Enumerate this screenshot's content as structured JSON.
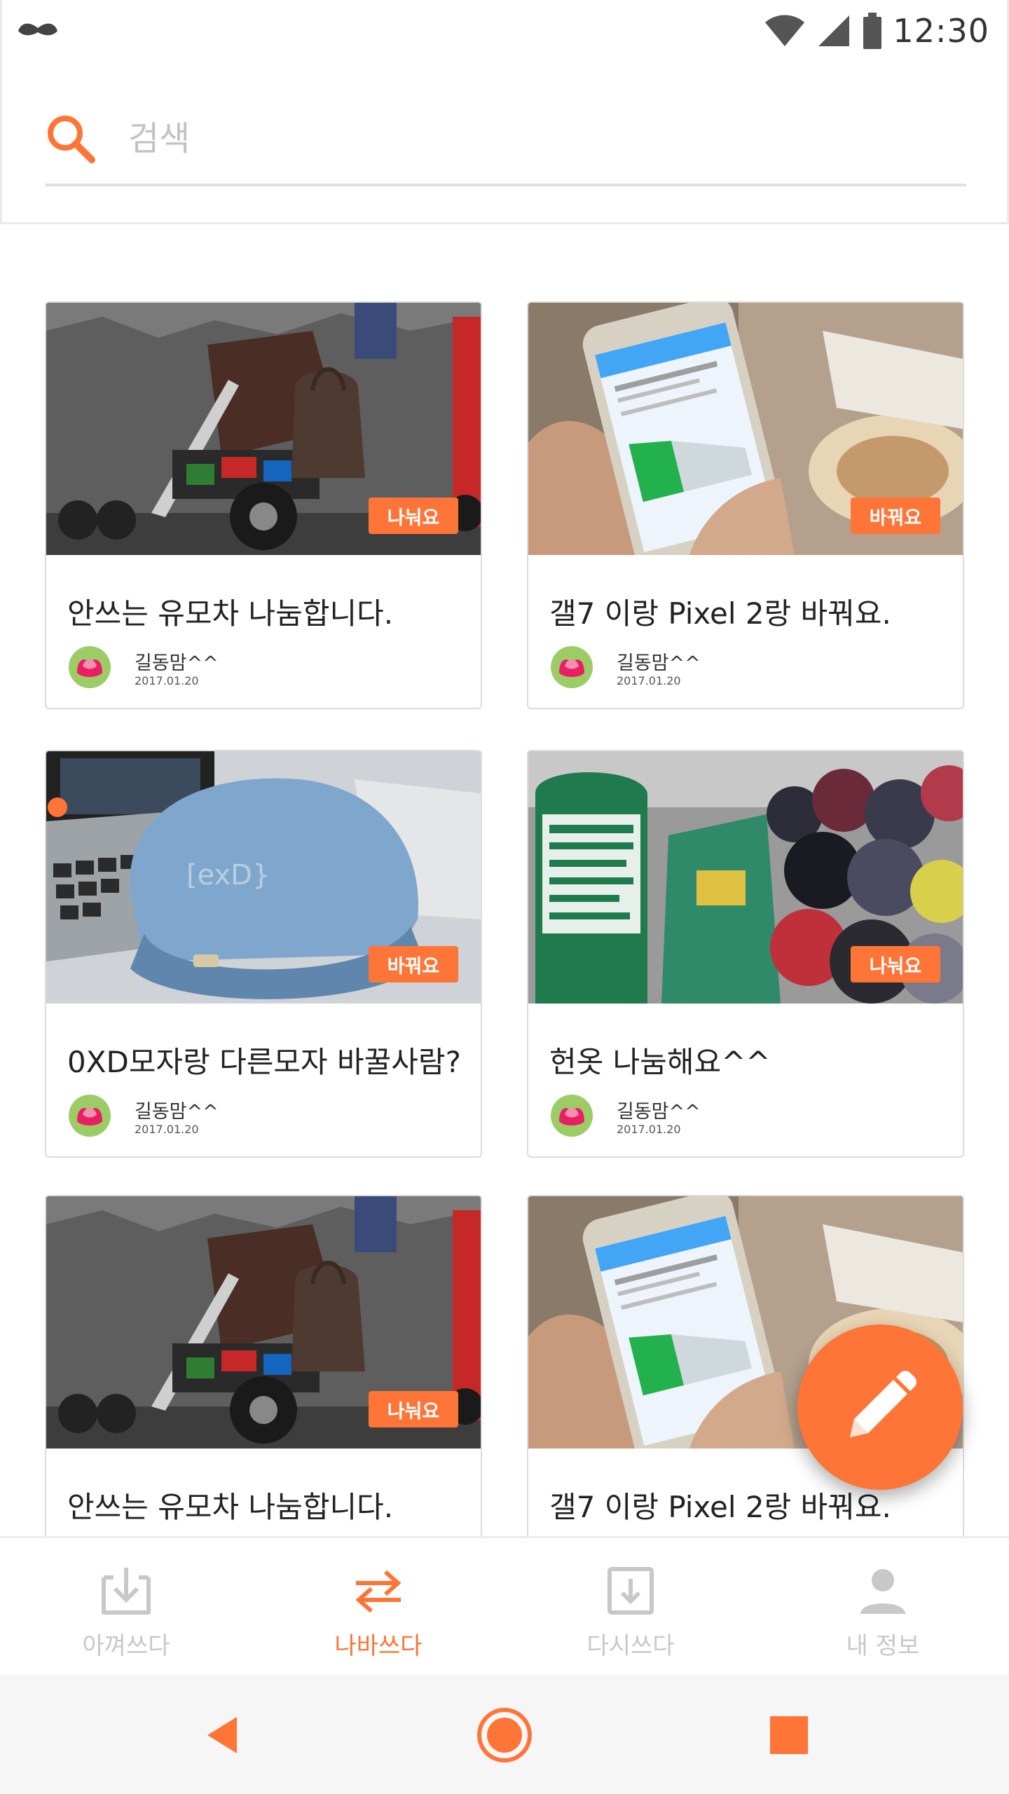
{
  "status_bar": {
    "time": "12:30"
  },
  "search": {
    "placeholder": "검색"
  },
  "cards": [
    {
      "title": "안쓰는 유모차 나눔합니다.",
      "badge": "나눠요",
      "author": "길동맘^^",
      "date": "2017.01.20",
      "image": "stroller-photo"
    },
    {
      "title": "갤7 이랑 Pixel 2랑 바꿔요.",
      "badge": "바꿔요",
      "author": "길동맘^^",
      "date": "2017.01.20",
      "image": "phone-photo"
    },
    {
      "title": "0XD모자랑 다른모자 바꿀사람?",
      "badge": "바꿔요",
      "author": "길동맘^^",
      "date": "2017.01.20",
      "image": "cap-photo"
    },
    {
      "title": "헌옷 나눔해요^^",
      "badge": "나눠요",
      "author": "길동맘^^",
      "date": "2017.01.20",
      "image": "clothes-photo"
    },
    {
      "title": "안쓰는 유모차 나눔합니다.",
      "badge": "나눠요",
      "image": "stroller-photo"
    },
    {
      "title": "갤7 이랑 Pixel 2랑 바꿔요.",
      "image": "phone-photo"
    }
  ],
  "fab": {
    "icon": "pencil-icon"
  },
  "bottom_nav": {
    "items": [
      {
        "label": "아껴쓰다",
        "icon": "download-tray-icon",
        "active": false
      },
      {
        "label": "나바쓰다",
        "icon": "swap-arrows-icon",
        "active": true
      },
      {
        "label": "다시쓰다",
        "icon": "reuse-tray-icon",
        "active": false
      },
      {
        "label": "내 정보",
        "icon": "person-icon",
        "active": false
      }
    ]
  },
  "colors": {
    "accent": "#ff7537",
    "inactive": "#c8c8c8",
    "border": "#dcdcdc"
  }
}
